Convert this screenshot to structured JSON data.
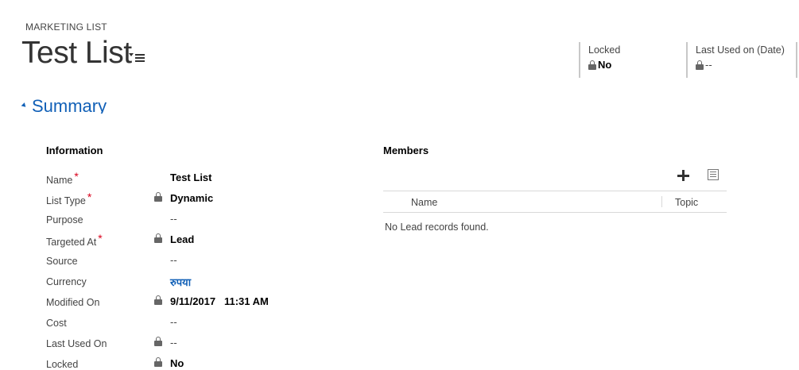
{
  "header": {
    "entity_type": "MARKETING LIST",
    "record_title": "Test List",
    "fields": [
      {
        "label": "Locked",
        "value": "No"
      },
      {
        "label": "Last Used on (Date)",
        "value": "--"
      }
    ]
  },
  "summary": {
    "section_title": "Summary",
    "information": {
      "heading": "Information",
      "required_marker": "*",
      "fields": [
        {
          "label": "Name",
          "value": "Test List"
        },
        {
          "label": "List Type",
          "value": "Dynamic"
        },
        {
          "label": "Purpose",
          "value": "--"
        },
        {
          "label": "Targeted At",
          "value": "Lead"
        },
        {
          "label": "Source",
          "value": "--"
        },
        {
          "label": "Currency",
          "value": "रुपया"
        },
        {
          "label": "Modified On",
          "value": "9/11/2017   11:31 AM"
        },
        {
          "label": "Cost",
          "value": "--"
        },
        {
          "label": "Last Used On",
          "value": "--"
        },
        {
          "label": "Locked",
          "value": "No"
        }
      ]
    },
    "members": {
      "heading": "Members",
      "columns": [
        "Name",
        "Topic"
      ],
      "empty_message": "No Lead records found."
    }
  },
  "colors": {
    "accent": "#1160b7",
    "required": "#d9001b",
    "label_text": "#444444"
  },
  "icons": [
    "title-menu-icon",
    "lock-icon",
    "add-icon",
    "grid-view-icon",
    "section-collapse-icon"
  ]
}
